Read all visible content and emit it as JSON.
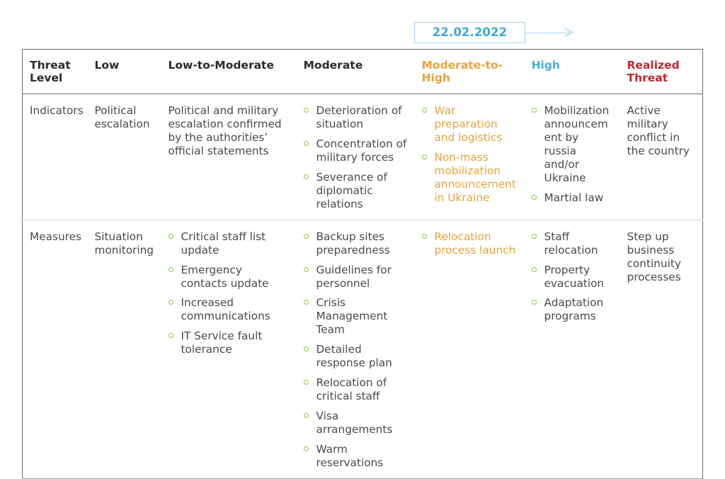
{
  "timeline": {
    "date_label": "22.02.2022",
    "arrow_icon": "arrow-right-icon",
    "accent_color": "#3fa9d8",
    "border_color": "#9ed4ec"
  },
  "table": {
    "columns": [
      {
        "label": "Threat\nLevel",
        "color": "#2b2b2b",
        "key": "threat_level"
      },
      {
        "label": "Low",
        "color": "#2b2b2b",
        "key": "low"
      },
      {
        "label": "Low-to-Moderate",
        "color": "#2b2b2b",
        "key": "low_to_moderate"
      },
      {
        "label": "Moderate",
        "color": "#2b2b2b",
        "key": "moderate"
      },
      {
        "label": "Moderate-to-High",
        "color": "#e8a33d",
        "key": "moderate_to_high"
      },
      {
        "label": "High",
        "color": "#4aaede",
        "key": "high"
      },
      {
        "label": "Realized\nThreat",
        "color": "#c0272d",
        "key": "realized_threat"
      }
    ],
    "header": {
      "threat_level_line1": "Threat",
      "threat_level_line2": "Level",
      "low": "Low",
      "low_to_moderate": "Low-to-Moderate",
      "moderate": "Moderate",
      "moderate_to_high": "Moderate-to-High",
      "high": "High",
      "realized_threat_line1": "Realized",
      "realized_threat_line2": "Threat"
    },
    "rows": [
      {
        "label": "Indicators",
        "low": "Political escalation",
        "low_to_moderate": "Political and military escalation confirmed by the authorities’ official statements",
        "moderate_items": [
          "Deterioration of situation",
          "Concentration of military forces",
          "Severance of diplomatic relations"
        ],
        "moderate_to_high_items": [
          "War preparation and logistics",
          "Non-mass mobilization announcement in Ukraine"
        ],
        "high_items": [
          "Mobilization announcement by russia and/or Ukraine",
          "Martial law"
        ],
        "realized_threat": "Active military conflict in the country"
      },
      {
        "label": "Measures",
        "low": "Situation monitoring",
        "low_to_moderate_items": [
          "Critical staff list update",
          "Emergency contacts update",
          "Increased communications",
          "IT Service fault tolerance"
        ],
        "moderate_items": [
          "Backup sites preparedness",
          "Guidelines for personnel",
          "Crisis Management Team",
          "Detailed response plan",
          "Relocation of critical staff",
          "Visa arrangements",
          "Warm reservations"
        ],
        "moderate_to_high_items": [
          "Relocation process launch"
        ],
        "high_items": [
          "Staff relocation",
          "Property evacuation",
          "Adaptation programs"
        ],
        "realized_threat": "Step up business continuity processes"
      }
    ],
    "bullet_color": "#8cc63f",
    "body_text_color": "#4a4a4a"
  }
}
